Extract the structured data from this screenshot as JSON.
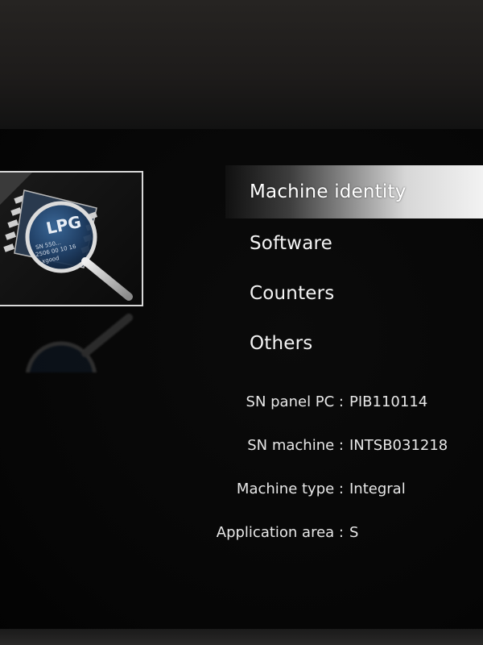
{
  "logo": {
    "brand": "LPG",
    "serial_text_lines": [
      "SN 550...",
      "2506 00 10 16",
      "xgood"
    ]
  },
  "menu": {
    "items": [
      {
        "label": "Machine identity",
        "selected": true
      },
      {
        "label": "Software",
        "selected": false
      },
      {
        "label": "Counters",
        "selected": false
      },
      {
        "label": "Others",
        "selected": false
      }
    ]
  },
  "info": {
    "rows": [
      {
        "label": "SN panel PC :",
        "value": "PIB110114"
      },
      {
        "label": "SN machine :",
        "value": "INTSB031218"
      },
      {
        "label": "Machine type :",
        "value": "Integral"
      },
      {
        "label": "Application area :",
        "value": "S"
      }
    ]
  },
  "colors": {
    "background": "#050505",
    "text": "#f4f4f4",
    "selection": "#e6e6e6",
    "logo_blue": "#1f3f66"
  }
}
